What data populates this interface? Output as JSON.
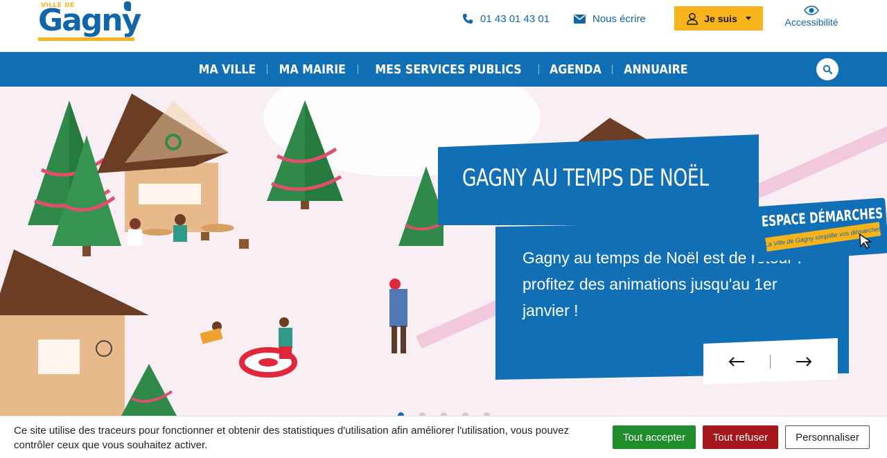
{
  "header": {
    "logo_small": "VILLE DE",
    "logo_main": "Gagny",
    "phone": "01 43 01 43 01",
    "mail": "Nous écrire",
    "je_suis": "Je suis",
    "accessibility": "Accessibilité"
  },
  "nav": {
    "items": [
      "MA VILLE",
      "MA MAIRIE",
      "MES SERVICES PUBLICS",
      "AGENDA",
      "ANNUAIRE"
    ]
  },
  "hero": {
    "title": "GAGNY AU TEMPS DE NOËL",
    "description": "Gagny au temps de Noël est de retour : profitez des animations jusqu'au 1er janvier !",
    "espace_title": "ESPACE DÉMARCHES",
    "espace_tagline": "La Ville de Gagny simplifie vos démarches",
    "slides_total": 5,
    "active_slide": 1
  },
  "cookie": {
    "text": "Ce site utilise des traceurs pour fonctionner et obtenir des statistiques d'utilisation afin améliorer l'utilisation, vous pouvez contrôler ceux que vous souhaitez activer.",
    "accept": "Tout accepter",
    "refuse": "Tout refuser",
    "customize": "Personnaliser"
  },
  "colors": {
    "brand_blue": "#1170b5",
    "brand_yellow": "#f7b31b",
    "accept_green": "#1f8d2c",
    "refuse_red": "#a6171c"
  }
}
